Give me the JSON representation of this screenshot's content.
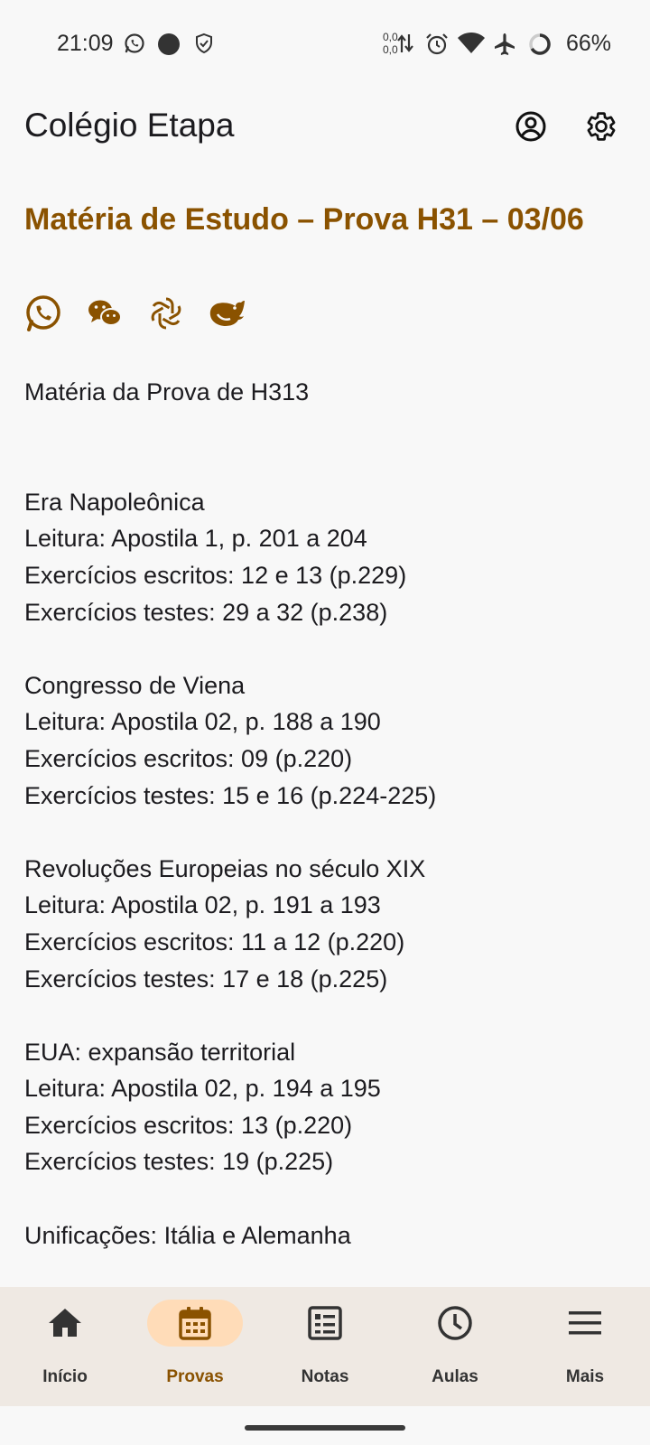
{
  "status_bar": {
    "time": "21:09",
    "net_up": "0,0",
    "net_down": "0,0",
    "battery": "66%",
    "left_icons": [
      "whatsapp-icon",
      "dot-icon",
      "shield-icon"
    ],
    "right_icons": [
      "data-arrows-icon",
      "alarm-icon",
      "wifi-icon",
      "airplane-icon",
      "battery-ring-icon"
    ]
  },
  "app_bar": {
    "title": "Colégio Etapa",
    "actions": [
      "account-icon",
      "settings-icon"
    ]
  },
  "page": {
    "title": "Matéria de Estudo – Prova H31 – 03/06",
    "share_icons": [
      "whatsapp-icon",
      "wechat-icon",
      "chatgpt-icon",
      "deepseek-icon"
    ],
    "lines": [
      "Matéria da Prova de H313",
      "",
      "",
      "Era Napoleônica",
      "Leitura: Apostila 1, p. 201 a 204",
      "Exercícios escritos: 12 e 13 (p.229)",
      "Exercícios testes: 29 a 32 (p.238)",
      "",
      "Congresso de Viena",
      "Leitura: Apostila 02, p. 188 a 190",
      "Exercícios escritos: 09 (p.220)",
      "Exercícios testes: 15 e 16 (p.224-225)",
      "",
      "Revoluções Europeias no século XIX",
      "Leitura: Apostila 02, p. 191 a 193",
      "Exercícios escritos: 11 a 12 (p.220)",
      "Exercícios testes: 17 e 18 (p.225)",
      "",
      "EUA: expansão territorial",
      "Leitura: Apostila 02, p. 194 a 195",
      "Exercícios escritos: 13 (p.220)",
      "Exercícios testes: 19 (p.225)",
      "",
      "Unificações: Itália e Alemanha"
    ]
  },
  "bottom_nav": {
    "items": [
      {
        "label": "Início",
        "icon": "home-icon",
        "active": false
      },
      {
        "label": "Provas",
        "icon": "calendar-icon",
        "active": true
      },
      {
        "label": "Notas",
        "icon": "grades-list-icon",
        "active": false
      },
      {
        "label": "Aulas",
        "icon": "clock-icon",
        "active": false
      },
      {
        "label": "Mais",
        "icon": "menu-icon",
        "active": false
      }
    ]
  },
  "colors": {
    "accent": "#8a5200",
    "active_pill": "#ffdcb8",
    "nav_background": "#efe9e3",
    "background": "#f8f8f8"
  }
}
